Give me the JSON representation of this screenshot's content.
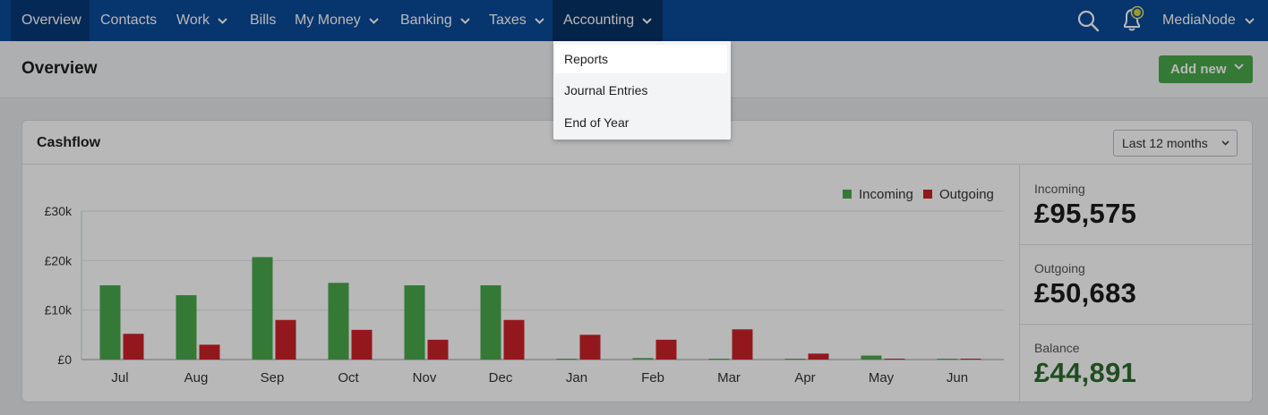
{
  "nav": {
    "items": [
      {
        "label": "Overview",
        "dropdown": false
      },
      {
        "label": "Contacts",
        "dropdown": false
      },
      {
        "label": "Work",
        "dropdown": true
      },
      {
        "label": "Bills",
        "dropdown": false
      },
      {
        "label": "My Money",
        "dropdown": true
      },
      {
        "label": "Banking",
        "dropdown": true
      },
      {
        "label": "Taxes",
        "dropdown": true
      },
      {
        "label": "Accounting",
        "dropdown": true
      }
    ],
    "user": "MediaNode",
    "icons": [
      "search-icon",
      "notification-bell-icon",
      "chevron-down-icon"
    ]
  },
  "accounting_menu": {
    "items": [
      "Reports",
      "Journal Entries",
      "End of Year"
    ],
    "highlighted": "Reports"
  },
  "page": {
    "title": "Overview",
    "add_new_label": "Add new"
  },
  "cashflow": {
    "title": "Cashflow",
    "range_selected": "Last 12 months",
    "summary": {
      "incoming_label": "Incoming",
      "incoming_value": "£95,575",
      "outgoing_label": "Outgoing",
      "outgoing_value": "£50,683",
      "balance_label": "Balance",
      "balance_value": "£44,891"
    }
  },
  "colors": {
    "nav_bg": "#0a4a98",
    "incoming": "#4aa84c",
    "outgoing": "#cc2229",
    "balance": "#2e6b2f",
    "add_button": "#4aa84c"
  },
  "chart_data": {
    "type": "bar",
    "categories": [
      "Jul",
      "Aug",
      "Sep",
      "Oct",
      "Nov",
      "Dec",
      "Jan",
      "Feb",
      "Mar",
      "Apr",
      "May",
      "Jun"
    ],
    "series": [
      {
        "name": "Incoming",
        "color": "#4aa84c",
        "values": [
          15000,
          13000,
          20700,
          15500,
          15000,
          15000,
          100,
          300,
          100,
          100,
          800,
          100
        ]
      },
      {
        "name": "Outgoing",
        "color": "#cc2229",
        "values": [
          5200,
          3000,
          8000,
          6000,
          4000,
          8000,
          5000,
          4000,
          6100,
          1200,
          100,
          100
        ]
      }
    ],
    "yticks": [
      "£0",
      "£10k",
      "£20k",
      "£30k"
    ],
    "ytick_values": [
      0,
      10000,
      20000,
      30000
    ],
    "ylim": [
      0,
      30000
    ],
    "grid": true,
    "legend_position": "top-right"
  }
}
